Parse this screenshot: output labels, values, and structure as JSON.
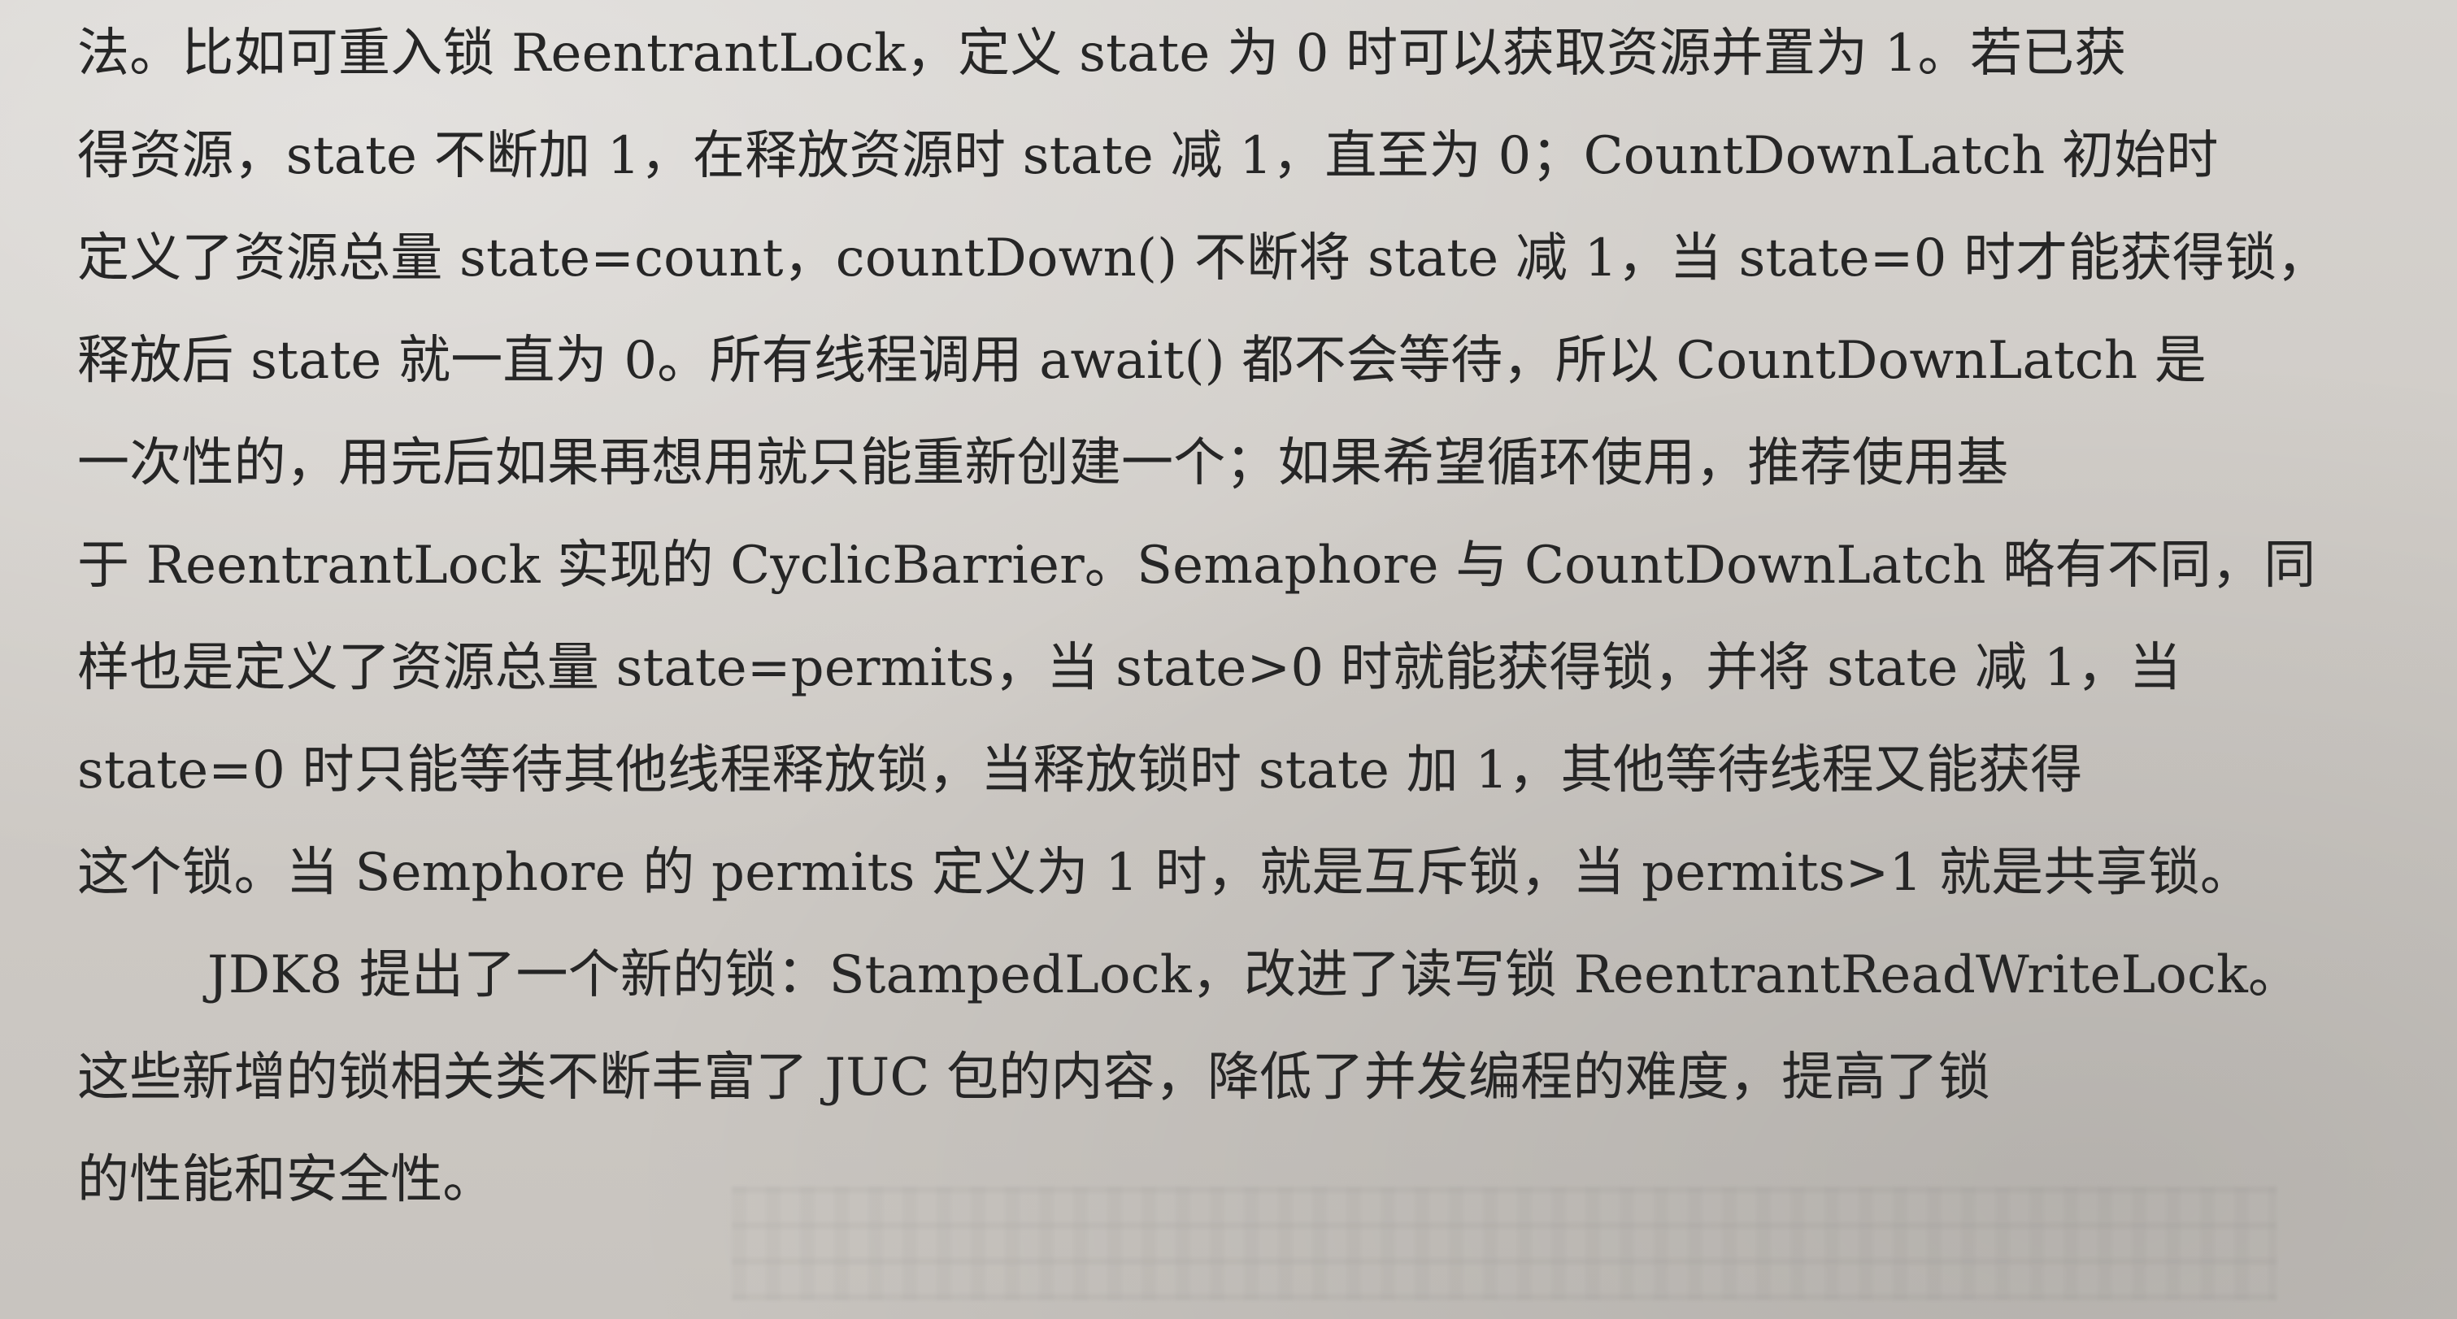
{
  "document": {
    "lines": [
      "法。比如可重入锁 ReentrantLock，定义 state 为 0 时可以获取资源并置为 1。若已获",
      "得资源，state 不断加 1，在释放资源时 state 减 1，直至为 0；CountDownLatch 初始时",
      "定义了资源总量 state=count，countDown() 不断将 state 减 1，当 state=0 时才能获得锁，",
      "释放后 state 就一直为 0。所有线程调用 await() 都不会等待，所以 CountDownLatch 是",
      "一次性的，用完后如果再想用就只能重新创建一个；如果希望循环使用，推荐使用基",
      "于 ReentrantLock 实现的 CyclicBarrier。Semaphore 与 CountDownLatch 略有不同，同",
      "样也是定义了资源总量 state=permits，当 state>0 时就能获得锁，并将 state 减 1，当",
      "state=0 时只能等待其他线程释放锁，当释放锁时 state 加 1，其他等待线程又能获得",
      "这个锁。当 Semphore 的 permits 定义为 1 时，就是互斥锁，当 permits>1 就是共享锁。",
      "JDK8 提出了一个新的锁：StampedLock，改进了读写锁 ReentrantReadWriteLock。",
      "这些新增的锁相关类不断丰富了 JUC 包的内容，降低了并发编程的难度，提高了锁",
      "的性能和安全性。"
    ]
  }
}
